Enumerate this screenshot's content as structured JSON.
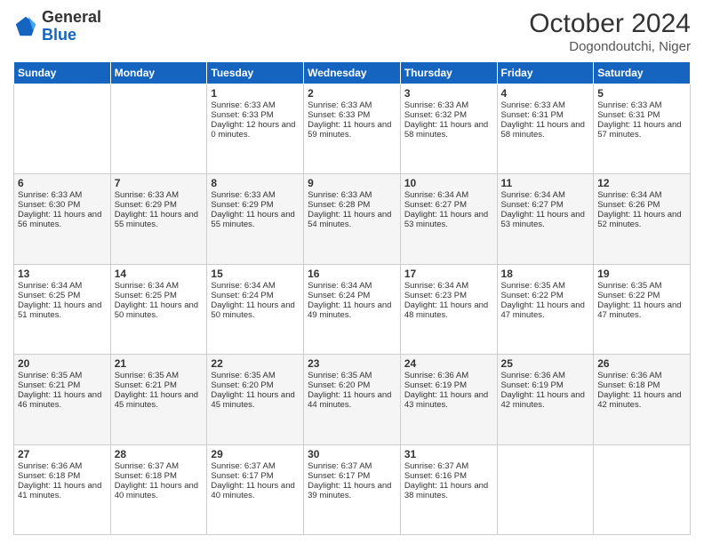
{
  "header": {
    "logo_line1": "General",
    "logo_line2": "Blue",
    "month_year": "October 2024",
    "location": "Dogondoutchi, Niger"
  },
  "days_of_week": [
    "Sunday",
    "Monday",
    "Tuesday",
    "Wednesday",
    "Thursday",
    "Friday",
    "Saturday"
  ],
  "weeks": [
    [
      {
        "day": "",
        "sunrise": "",
        "sunset": "",
        "daylight": ""
      },
      {
        "day": "",
        "sunrise": "",
        "sunset": "",
        "daylight": ""
      },
      {
        "day": "1",
        "sunrise": "Sunrise: 6:33 AM",
        "sunset": "Sunset: 6:33 PM",
        "daylight": "Daylight: 12 hours and 0 minutes."
      },
      {
        "day": "2",
        "sunrise": "Sunrise: 6:33 AM",
        "sunset": "Sunset: 6:33 PM",
        "daylight": "Daylight: 11 hours and 59 minutes."
      },
      {
        "day": "3",
        "sunrise": "Sunrise: 6:33 AM",
        "sunset": "Sunset: 6:32 PM",
        "daylight": "Daylight: 11 hours and 58 minutes."
      },
      {
        "day": "4",
        "sunrise": "Sunrise: 6:33 AM",
        "sunset": "Sunset: 6:31 PM",
        "daylight": "Daylight: 11 hours and 58 minutes."
      },
      {
        "day": "5",
        "sunrise": "Sunrise: 6:33 AM",
        "sunset": "Sunset: 6:31 PM",
        "daylight": "Daylight: 11 hours and 57 minutes."
      }
    ],
    [
      {
        "day": "6",
        "sunrise": "Sunrise: 6:33 AM",
        "sunset": "Sunset: 6:30 PM",
        "daylight": "Daylight: 11 hours and 56 minutes."
      },
      {
        "day": "7",
        "sunrise": "Sunrise: 6:33 AM",
        "sunset": "Sunset: 6:29 PM",
        "daylight": "Daylight: 11 hours and 55 minutes."
      },
      {
        "day": "8",
        "sunrise": "Sunrise: 6:33 AM",
        "sunset": "Sunset: 6:29 PM",
        "daylight": "Daylight: 11 hours and 55 minutes."
      },
      {
        "day": "9",
        "sunrise": "Sunrise: 6:33 AM",
        "sunset": "Sunset: 6:28 PM",
        "daylight": "Daylight: 11 hours and 54 minutes."
      },
      {
        "day": "10",
        "sunrise": "Sunrise: 6:34 AM",
        "sunset": "Sunset: 6:27 PM",
        "daylight": "Daylight: 11 hours and 53 minutes."
      },
      {
        "day": "11",
        "sunrise": "Sunrise: 6:34 AM",
        "sunset": "Sunset: 6:27 PM",
        "daylight": "Daylight: 11 hours and 53 minutes."
      },
      {
        "day": "12",
        "sunrise": "Sunrise: 6:34 AM",
        "sunset": "Sunset: 6:26 PM",
        "daylight": "Daylight: 11 hours and 52 minutes."
      }
    ],
    [
      {
        "day": "13",
        "sunrise": "Sunrise: 6:34 AM",
        "sunset": "Sunset: 6:25 PM",
        "daylight": "Daylight: 11 hours and 51 minutes."
      },
      {
        "day": "14",
        "sunrise": "Sunrise: 6:34 AM",
        "sunset": "Sunset: 6:25 PM",
        "daylight": "Daylight: 11 hours and 50 minutes."
      },
      {
        "day": "15",
        "sunrise": "Sunrise: 6:34 AM",
        "sunset": "Sunset: 6:24 PM",
        "daylight": "Daylight: 11 hours and 50 minutes."
      },
      {
        "day": "16",
        "sunrise": "Sunrise: 6:34 AM",
        "sunset": "Sunset: 6:24 PM",
        "daylight": "Daylight: 11 hours and 49 minutes."
      },
      {
        "day": "17",
        "sunrise": "Sunrise: 6:34 AM",
        "sunset": "Sunset: 6:23 PM",
        "daylight": "Daylight: 11 hours and 48 minutes."
      },
      {
        "day": "18",
        "sunrise": "Sunrise: 6:35 AM",
        "sunset": "Sunset: 6:22 PM",
        "daylight": "Daylight: 11 hours and 47 minutes."
      },
      {
        "day": "19",
        "sunrise": "Sunrise: 6:35 AM",
        "sunset": "Sunset: 6:22 PM",
        "daylight": "Daylight: 11 hours and 47 minutes."
      }
    ],
    [
      {
        "day": "20",
        "sunrise": "Sunrise: 6:35 AM",
        "sunset": "Sunset: 6:21 PM",
        "daylight": "Daylight: 11 hours and 46 minutes."
      },
      {
        "day": "21",
        "sunrise": "Sunrise: 6:35 AM",
        "sunset": "Sunset: 6:21 PM",
        "daylight": "Daylight: 11 hours and 45 minutes."
      },
      {
        "day": "22",
        "sunrise": "Sunrise: 6:35 AM",
        "sunset": "Sunset: 6:20 PM",
        "daylight": "Daylight: 11 hours and 45 minutes."
      },
      {
        "day": "23",
        "sunrise": "Sunrise: 6:35 AM",
        "sunset": "Sunset: 6:20 PM",
        "daylight": "Daylight: 11 hours and 44 minutes."
      },
      {
        "day": "24",
        "sunrise": "Sunrise: 6:36 AM",
        "sunset": "Sunset: 6:19 PM",
        "daylight": "Daylight: 11 hours and 43 minutes."
      },
      {
        "day": "25",
        "sunrise": "Sunrise: 6:36 AM",
        "sunset": "Sunset: 6:19 PM",
        "daylight": "Daylight: 11 hours and 42 minutes."
      },
      {
        "day": "26",
        "sunrise": "Sunrise: 6:36 AM",
        "sunset": "Sunset: 6:18 PM",
        "daylight": "Daylight: 11 hours and 42 minutes."
      }
    ],
    [
      {
        "day": "27",
        "sunrise": "Sunrise: 6:36 AM",
        "sunset": "Sunset: 6:18 PM",
        "daylight": "Daylight: 11 hours and 41 minutes."
      },
      {
        "day": "28",
        "sunrise": "Sunrise: 6:37 AM",
        "sunset": "Sunset: 6:18 PM",
        "daylight": "Daylight: 11 hours and 40 minutes."
      },
      {
        "day": "29",
        "sunrise": "Sunrise: 6:37 AM",
        "sunset": "Sunset: 6:17 PM",
        "daylight": "Daylight: 11 hours and 40 minutes."
      },
      {
        "day": "30",
        "sunrise": "Sunrise: 6:37 AM",
        "sunset": "Sunset: 6:17 PM",
        "daylight": "Daylight: 11 hours and 39 minutes."
      },
      {
        "day": "31",
        "sunrise": "Sunrise: 6:37 AM",
        "sunset": "Sunset: 6:16 PM",
        "daylight": "Daylight: 11 hours and 38 minutes."
      },
      {
        "day": "",
        "sunrise": "",
        "sunset": "",
        "daylight": ""
      },
      {
        "day": "",
        "sunrise": "",
        "sunset": "",
        "daylight": ""
      }
    ]
  ]
}
